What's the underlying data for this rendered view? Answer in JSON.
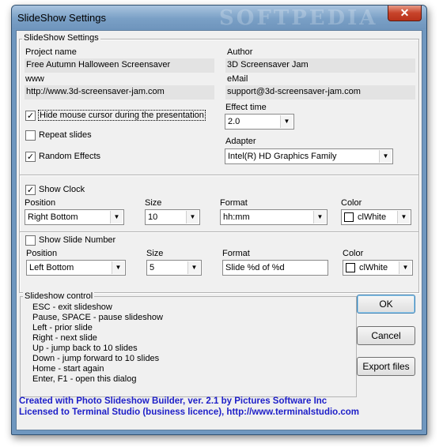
{
  "window": {
    "title": "SlideShow Settings",
    "watermark": "SOFTPEDIA",
    "close_glyph": "✕"
  },
  "settings_group": {
    "legend": "SlideShow Settings",
    "project_name_label": "Project name",
    "project_name_value": "Free Autumn Halloween Screensaver",
    "author_label": "Author",
    "author_value": "3D Screensaver Jam",
    "www_label": "www",
    "www_value": "http://www.3d-screensaver-jam.com",
    "email_label": "eMail",
    "email_value": "support@3d-screensaver-jam.com",
    "hide_cursor_label": "Hide mouse cursor during the presentation",
    "hide_cursor_checked": true,
    "repeat_label": "Repeat slides",
    "repeat_checked": false,
    "random_effects_label": "Random Effects",
    "random_effects_checked": true,
    "effect_time_label": "Effect time",
    "effect_time_value": "2.0",
    "adapter_label": "Adapter",
    "adapter_value": "Intel(R) HD Graphics Family",
    "show_clock_label": "Show Clock",
    "show_clock_checked": true,
    "clock_position_label": "Position",
    "clock_position_value": "Right Bottom",
    "clock_size_label": "Size",
    "clock_size_value": "10",
    "clock_format_label": "Format",
    "clock_format_value": "hh:mm",
    "clock_color_label": "Color",
    "clock_color_value": "clWhite",
    "clock_color_hex": "#ffffff",
    "show_slide_number_label": "Show Slide Number",
    "show_slide_number_checked": false,
    "slide_position_label": "Position",
    "slide_position_value": "Left Bottom",
    "slide_size_label": "Size",
    "slide_size_value": "5",
    "slide_format_label": "Format",
    "slide_format_value": "Slide %d of %d",
    "slide_color_label": "Color",
    "slide_color_value": "clWhite",
    "slide_color_hex": "#ffffff"
  },
  "slideshow_control": {
    "legend": "Slideshow control",
    "lines": [
      "ESC - exit slideshow",
      "Pause, SPACE - pause slideshow",
      "Left - prior slide",
      "Right - next slide",
      "Up - jump back to 10 slides",
      "Down - jump forward to 10 slides",
      "Home - start again",
      "Enter, F1 - open this dialog"
    ]
  },
  "buttons": {
    "ok": "OK",
    "cancel": "Cancel",
    "export": "Export files"
  },
  "credits": {
    "line1": "Created with Photo Slideshow Builder, ver. 2.1   by Pictures Software Inc",
    "line2": "Licensed to Terminal Studio (business licence), http://www.terminalstudio.com",
    "color": "#1f20c8"
  },
  "icons": {
    "check": "✓",
    "dropdown": "▼"
  }
}
